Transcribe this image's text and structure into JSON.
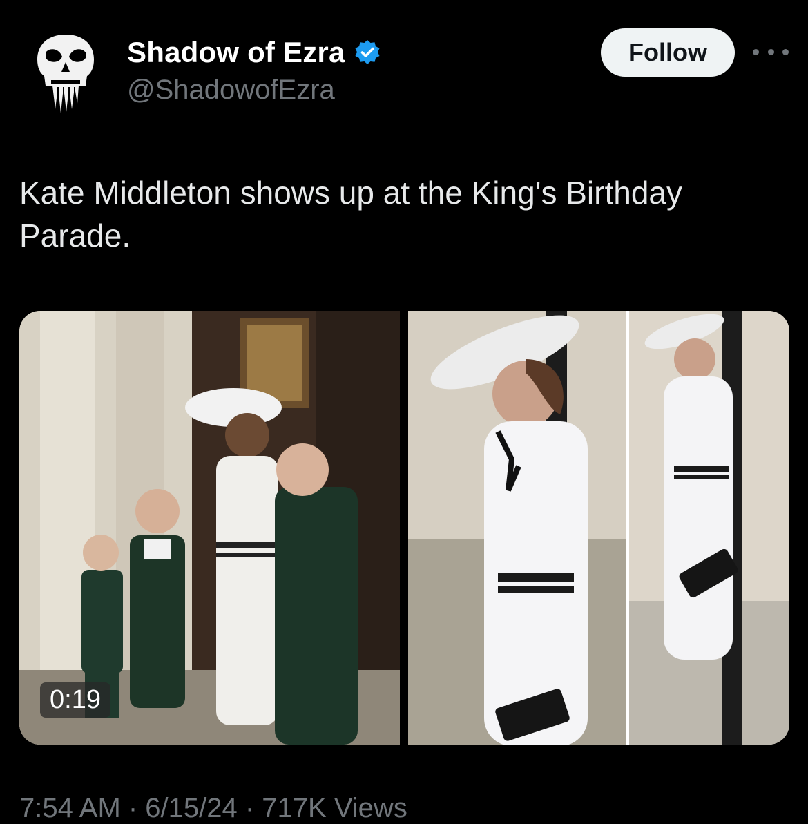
{
  "post": {
    "display_name": "Shadow of Ezra",
    "handle": "@ShadowofEzra",
    "verified_icon": "verified-badge-icon",
    "follow_label": "Follow",
    "more_icon": "more-options-icon",
    "text": "Kate Middleton shows up at the King's Birthday Parade.",
    "timestamp": "7:54 AM · 6/15/24 · 717K Views"
  },
  "media": {
    "video_duration": "0:19"
  },
  "colors": {
    "background": "#000000",
    "text_primary": "#e7e9ea",
    "text_secondary": "#71767b",
    "verified": "#1d9bf0",
    "follow_bg": "#eff3f4"
  }
}
